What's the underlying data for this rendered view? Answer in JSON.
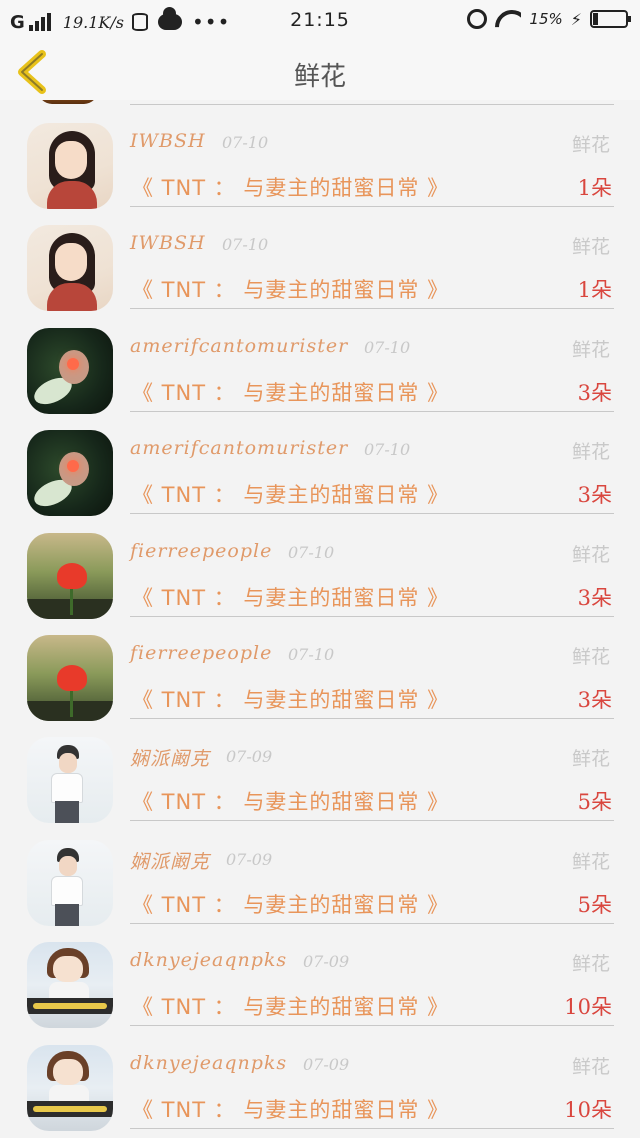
{
  "status_bar": {
    "network": "G",
    "speed": "19.1K/s",
    "time": "21:15",
    "battery_pct": "15%",
    "battery_level": 0.15,
    "icons": [
      "signal-icon",
      "database-icon",
      "cloud-icon",
      "more-dots-icon",
      "alarm-icon",
      "wifi-icon",
      "charging-icon",
      "battery-icon"
    ]
  },
  "nav": {
    "title": "鲜花",
    "back_icon": "chevron-left-icon",
    "accent": "#e8c21a"
  },
  "colors": {
    "username": "#e09a6a",
    "book": "#e8955a",
    "count": "#d9463e",
    "date": "#c8c8c8",
    "gift": "#c9c9c9"
  },
  "items": [
    {
      "username": "IWBSH",
      "date": "07-10",
      "gift": "鲜花",
      "book": "《 TNT ： 与妻主的甜蜜日常 》",
      "count": "1朵",
      "avatar": "girl"
    },
    {
      "username": "IWBSH",
      "date": "07-10",
      "gift": "鲜花",
      "book": "《 TNT ： 与妻主的甜蜜日常 》",
      "count": "1朵",
      "avatar": "girl"
    },
    {
      "username": "amerifcantomurister",
      "date": "07-10",
      "gift": "鲜花",
      "book": "《 TNT ： 与妻主的甜蜜日常 》",
      "count": "3朵",
      "avatar": "dark"
    },
    {
      "username": "amerifcantomurister",
      "date": "07-10",
      "gift": "鲜花",
      "book": "《 TNT ： 与妻主的甜蜜日常 》",
      "count": "3朵",
      "avatar": "dark"
    },
    {
      "username": "fierreepeople",
      "date": "07-10",
      "gift": "鲜花",
      "book": "《 TNT ： 与妻主的甜蜜日常 》",
      "count": "3朵",
      "avatar": "flower"
    },
    {
      "username": "fierreepeople",
      "date": "07-10",
      "gift": "鲜花",
      "book": "《 TNT ： 与妻主的甜蜜日常 》",
      "count": "3朵",
      "avatar": "flower"
    },
    {
      "username": "娴派阚克",
      "date": "07-09",
      "gift": "鲜花",
      "book": "《 TNT ： 与妻主的甜蜜日常 》",
      "count": "5朵",
      "avatar": "boy"
    },
    {
      "username": "娴派阚克",
      "date": "07-09",
      "gift": "鲜花",
      "book": "《 TNT ： 与妻主的甜蜜日常 》",
      "count": "5朵",
      "avatar": "boy"
    },
    {
      "username": "dknyejeaqnpks",
      "date": "07-09",
      "gift": "鲜花",
      "book": "《 TNT ： 与妻主的甜蜜日常 》",
      "count": "10朵",
      "avatar": "cute"
    },
    {
      "username": "dknyejeaqnpks",
      "date": "07-09",
      "gift": "鲜花",
      "book": "《 TNT ： 与妻主的甜蜜日常 》",
      "count": "10朵",
      "avatar": "cute"
    }
  ]
}
